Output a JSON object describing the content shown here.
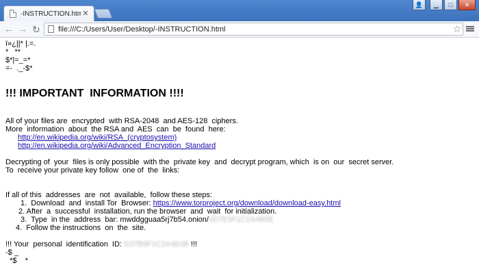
{
  "tab": {
    "title": "-INSTRUCTION.html"
  },
  "window_controls": {
    "user": "👤",
    "minimize": "▁",
    "maximize": "□",
    "close": "✕"
  },
  "toolbar": {
    "back": "←",
    "forward": "→",
    "reload": "↻",
    "url": "file:///C:/Users/User/Desktop/-INSTRUCTION.html",
    "star": "☆"
  },
  "page": {
    "garbage_lines": [
      "ï»¿||* |.=.",
      "*   **",
      "$*|=_=*",
      "=-  ._-$*"
    ],
    "headline": "!!! IMPORTANT  INFORMATION !!!!",
    "para1_line1": "All of your files are  encrypted  with RSA-2048  and AES-128  ciphers.",
    "para1_line2": "More  information  about  the RSA and  AES  can  be  found  here:",
    "link_rsa": "http://en.wikipedia.org/wiki/RSA_(cryptosystem)",
    "link_aes": "http://en.wikipedia.org/wiki/Advanced_Encryption_Standard",
    "para2_line1": "Decrypting of  your  files is only possible  with the  private key  and  decrypt program, which  is on  our  secret server.",
    "para2_line2": "To  receive your private key follow  one of  the  links:",
    "para3_line1": "If all of this  addresses  are  not  available,  follow these steps:",
    "step1_text": "1.  Download  and  install Tor  Browser: ",
    "step1_link": "https://www.torproject.org/download/download-easy.html",
    "step2_text": "2. After  a  successful  installation, run the browser  and  wait  for initialization.",
    "step3_text": "3.  Type  in the  address  bar: mwddgguaa5rj7b54.onion/",
    "step3_blur": "0D7E9F1C2A4B5E",
    "step4_text": "4.  Follow the instructions  on  the  site.",
    "id_label": "!!! Your  personal  identification  ID: ",
    "id_blur": "D37B9F1C2A4E0B",
    "id_end": " !!!",
    "tail_line1": "-$ _",
    "tail_line2": "  *$    *"
  }
}
